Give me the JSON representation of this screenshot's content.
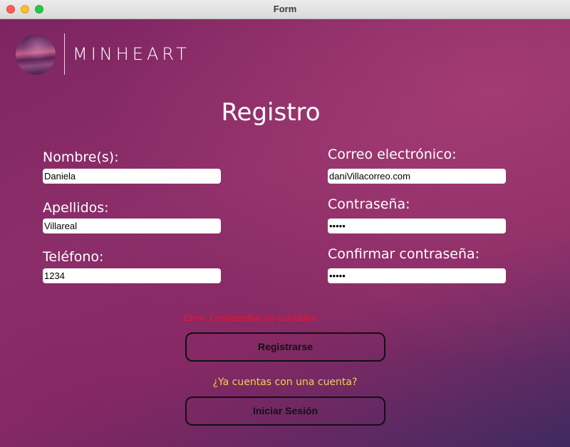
{
  "window": {
    "title": "Form"
  },
  "logo": {
    "text": "MINHEART"
  },
  "form": {
    "heading": "Registro",
    "fields": {
      "nombre": {
        "label": "Nombre(s):",
        "value": "Daniela"
      },
      "apellidos": {
        "label": "Apellidos:",
        "value": "Villareal"
      },
      "telefono": {
        "label": "Teléfono:",
        "value": "1234"
      },
      "correo": {
        "label": "Correo electrónico:",
        "value": "daniVillacorreo.com"
      },
      "contrasena": {
        "label": "Contraseña:",
        "value": "•••••"
      },
      "confirmar": {
        "label": "Confirmar contraseña:",
        "value": "•••••"
      }
    },
    "error_message": "Error: Contraseñas no coinciden",
    "register_button": "Registrarse",
    "account_question": "¿Ya cuentas con una cuenta?",
    "login_button": "Iniciar Sesión"
  },
  "colors": {
    "error": "#e8182c",
    "question": "#f1d24a",
    "button_border": "#111111"
  }
}
